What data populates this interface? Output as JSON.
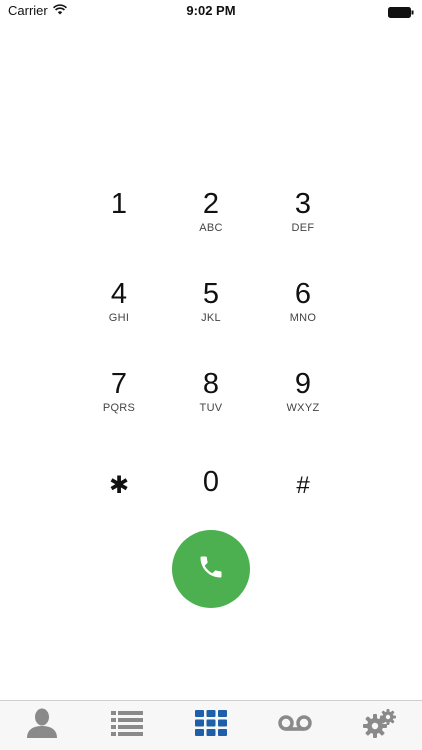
{
  "status_bar": {
    "carrier": "Carrier",
    "time": "9:02 PM",
    "wifi_icon": "wifi-icon",
    "battery_icon": "battery-icon"
  },
  "keypad": {
    "keys": [
      {
        "digit": "1",
        "letters": ""
      },
      {
        "digit": "2",
        "letters": "ABC"
      },
      {
        "digit": "3",
        "letters": "DEF"
      },
      {
        "digit": "4",
        "letters": "GHI"
      },
      {
        "digit": "5",
        "letters": "JKL"
      },
      {
        "digit": "6",
        "letters": "MNO"
      },
      {
        "digit": "7",
        "letters": "PQRS"
      },
      {
        "digit": "8",
        "letters": "TUV"
      },
      {
        "digit": "9",
        "letters": "WXYZ"
      },
      {
        "digit": "✱",
        "letters": ""
      },
      {
        "digit": "0",
        "letters": ""
      },
      {
        "digit": "#",
        "letters": ""
      }
    ]
  },
  "call_button": {
    "icon": "phone-icon",
    "color": "#4caf50"
  },
  "tab_bar": {
    "tabs": [
      {
        "icon": "contacts-icon",
        "active": false
      },
      {
        "icon": "list-icon",
        "active": false
      },
      {
        "icon": "keypad-icon",
        "active": true
      },
      {
        "icon": "voicemail-icon",
        "active": false
      },
      {
        "icon": "settings-icon",
        "active": false
      }
    ],
    "active_color": "#1d5fa8",
    "inactive_color": "#8a8a8a"
  }
}
